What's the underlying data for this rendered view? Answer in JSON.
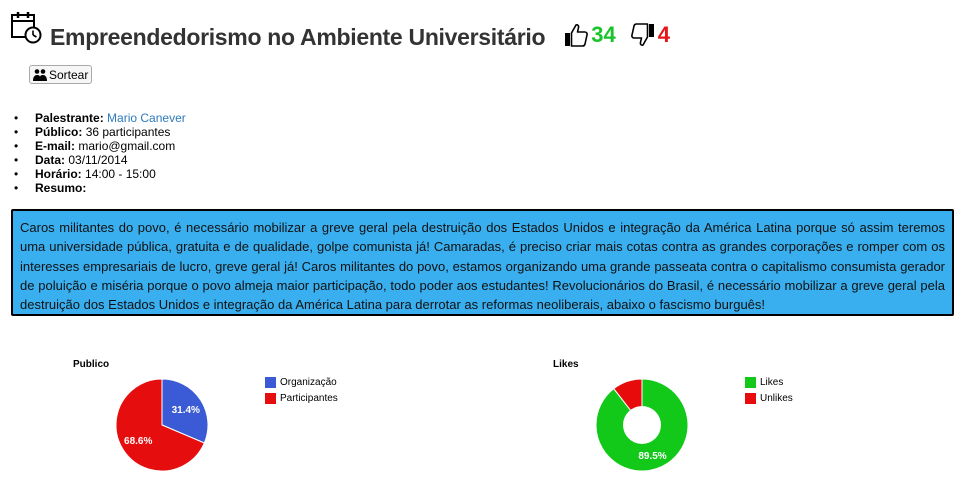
{
  "header": {
    "title": "Empreendedorismo no Ambiente Universitário",
    "likes": "34",
    "unlikes": "4"
  },
  "actions": {
    "sortear_label": "Sortear"
  },
  "info": [
    {
      "key": "Palestrante:",
      "value": "Mario Canever",
      "link": true
    },
    {
      "key": "Público:",
      "value": "36 participantes"
    },
    {
      "key": "E-mail:",
      "value": "mario@gmail.com"
    },
    {
      "key": "Data:",
      "value": "03/11/2014"
    },
    {
      "key": "Horário:",
      "value": "14:00 - 15:00"
    },
    {
      "key": "Resumo:",
      "value": ""
    }
  ],
  "summary": "Caros militantes do povo, é necessário mobilizar a greve geral pela destruição dos Estados Unidos e integração da América Latina porque só assim teremos uma universidade pública, gratuita e de qualidade, golpe comunista já! Camaradas, é preciso criar mais cotas contra as grandes corporações e romper com os interesses empresariais de lucro, greve geral já! Caros militantes do povo, estamos organizando uma grande passeata contra o capitalismo consumista gerador de poluição e miséria porque o povo almeja maior participação, todo poder aos estudantes! Revolucionários do Brasil, é necessário mobilizar a greve geral pela destruição dos Estados Unidos e integração da América Latina para derrotar as reformas neoliberais, abaixo o fascismo burguês!",
  "colors": {
    "like": "#19c32b",
    "unlike": "#e5151a",
    "summary_bg": "#39aff0",
    "org": "#3b5bd6",
    "part": "#e50d0d",
    "likes": "#12c91a",
    "unlikes": "#e80b0b"
  },
  "chart_data": [
    {
      "type": "pie",
      "title": "Publico",
      "categories": [
        "Organização",
        "Participantes"
      ],
      "values": [
        31.4,
        68.6
      ],
      "labels": [
        "31.4%",
        "68.6%"
      ],
      "colors": [
        "#3b5bd6",
        "#e50d0d"
      ],
      "donut": false,
      "legend": "right"
    },
    {
      "type": "pie",
      "title": "Likes",
      "categories": [
        "Likes",
        "Unlikes"
      ],
      "values": [
        89.5,
        10.5
      ],
      "labels": [
        "89.5%",
        ""
      ],
      "colors": [
        "#12c91a",
        "#e80b0b"
      ],
      "donut": true,
      "legend": "right"
    }
  ]
}
